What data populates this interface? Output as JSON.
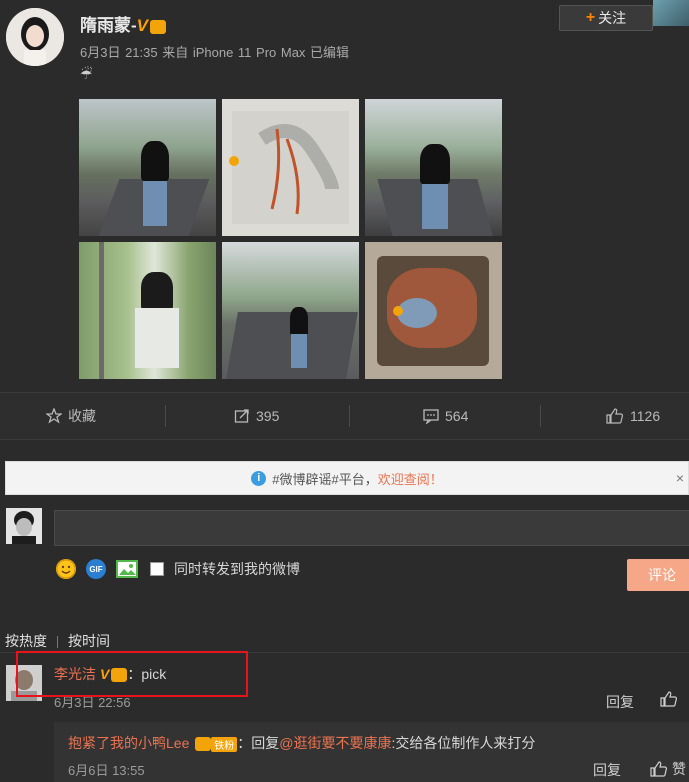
{
  "post": {
    "username": "隋雨蒙-",
    "verified_mark": "V",
    "meta": "6月3日 21:35 来自 iPhone 11 Pro Max  已编辑",
    "weather_icon": "☔",
    "follow_label": "关注",
    "images": [
      "photo-road-1",
      "photo-sketch",
      "photo-road-2",
      "photo-window",
      "photo-road-3",
      "photo-food"
    ]
  },
  "actions": {
    "favorite_label": "收藏",
    "repost_count": "395",
    "comment_count": "564",
    "like_count": "1126"
  },
  "notice": {
    "prefix": "#微博辟谣#平台，",
    "highlight": "欢迎查阅！"
  },
  "composer": {
    "sync_label": "同时转发到我的微博",
    "submit_label": "评论"
  },
  "sort": {
    "hot_label": "按热度",
    "time_label": "按时间"
  },
  "comment": {
    "name": "李光洁",
    "verified_mark": "V",
    "text": "：pick",
    "time": "6月3日 22:56",
    "reply_label": "回复"
  },
  "sub_reply": {
    "name": "抱紧了我的小鸭Lee",
    "badge": "铁粉",
    "reply_prefix": "：回复",
    "mention": "@逛街要不要康康",
    "text": ":交给各位制作人来打分",
    "time": "6月6日 13:55",
    "reply_label": "回复",
    "like_label": "赞"
  },
  "colors": {
    "accent": "#eb7350",
    "brand_orange": "#ff8200",
    "verified": "#ffa100",
    "highlight_box": "#e8141b",
    "submit_bg": "#f6a788"
  }
}
